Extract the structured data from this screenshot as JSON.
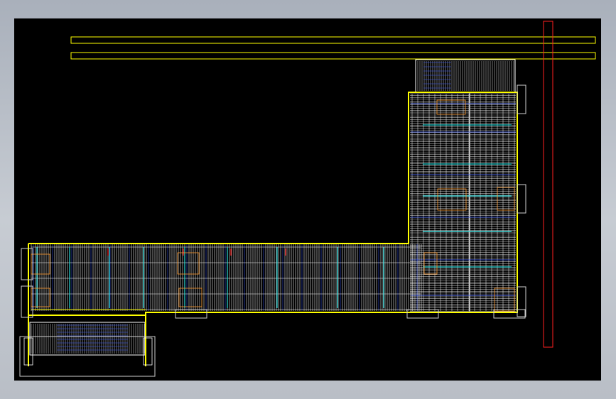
{
  "drawing": {
    "background": "#000000",
    "colors": {
      "wall": "#ffff00",
      "grid": "#ffffff",
      "blue": "#3d5cff",
      "cyan": "#2fe0e0",
      "orange": "#ff9a2e",
      "red": "#ff2020",
      "frame": "#ffffff"
    }
  }
}
